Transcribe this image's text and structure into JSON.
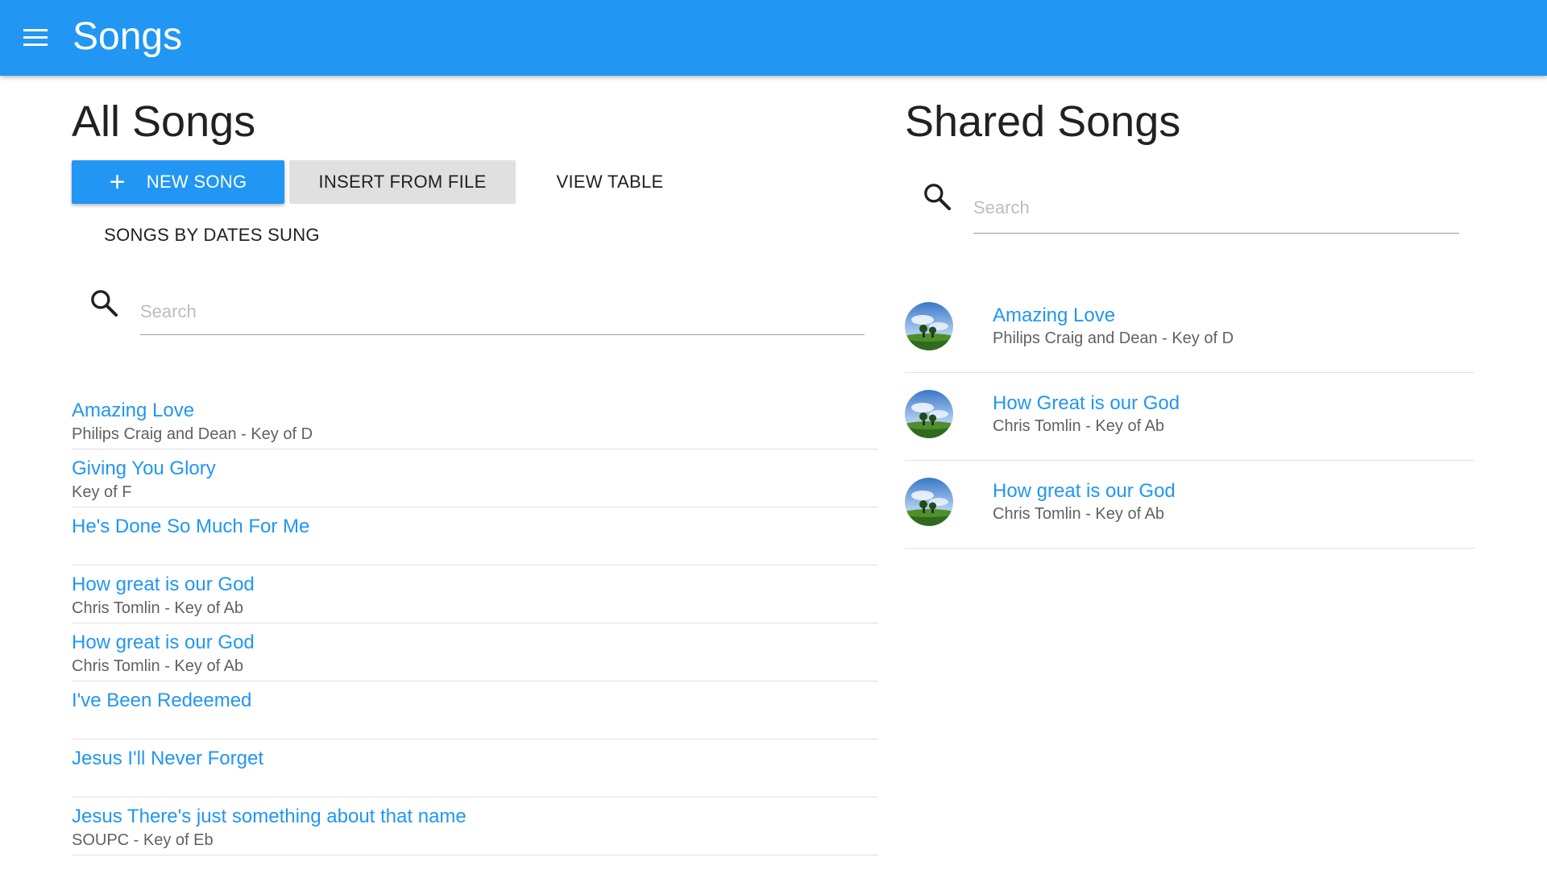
{
  "appbar": {
    "title": "Songs",
    "menu_icon": "menu-icon",
    "color": "#2196f3"
  },
  "all_songs": {
    "heading": "All Songs",
    "buttons": {
      "new_song": "NEW SONG",
      "insert_from_file": "INSERT FROM FILE",
      "view_table": "VIEW TABLE",
      "songs_by_dates_sung": "SONGS BY DATES SUNG"
    },
    "search": {
      "placeholder": "Search",
      "value": ""
    },
    "songs": [
      {
        "title": "Amazing Love",
        "subtitle": "Philips Craig and Dean - Key of D"
      },
      {
        "title": "Giving You Glory",
        "subtitle": "Key of F"
      },
      {
        "title": "He's Done So Much For Me",
        "subtitle": ""
      },
      {
        "title": "How great is our God",
        "subtitle": "Chris Tomlin - Key of Ab"
      },
      {
        "title": "How great is our God",
        "subtitle": "Chris Tomlin - Key of Ab"
      },
      {
        "title": "I've Been Redeemed",
        "subtitle": ""
      },
      {
        "title": "Jesus I'll Never Forget",
        "subtitle": ""
      },
      {
        "title": "Jesus There's just something about that name",
        "subtitle": "SOUPC - Key of Eb"
      }
    ]
  },
  "shared_songs": {
    "heading": "Shared Songs",
    "search": {
      "placeholder": "Search",
      "value": ""
    },
    "songs": [
      {
        "title": "Amazing Love",
        "subtitle": "Philips Craig and Dean - Key of D"
      },
      {
        "title": "How Great is our God",
        "subtitle": "Chris Tomlin - Key of Ab"
      },
      {
        "title": "How great is our God",
        "subtitle": "Chris Tomlin - Key of Ab"
      }
    ]
  },
  "colors": {
    "accent": "#2196f3",
    "link": "#2196f3",
    "secondary_text": "#616161",
    "divider": "#e0e0e0"
  }
}
